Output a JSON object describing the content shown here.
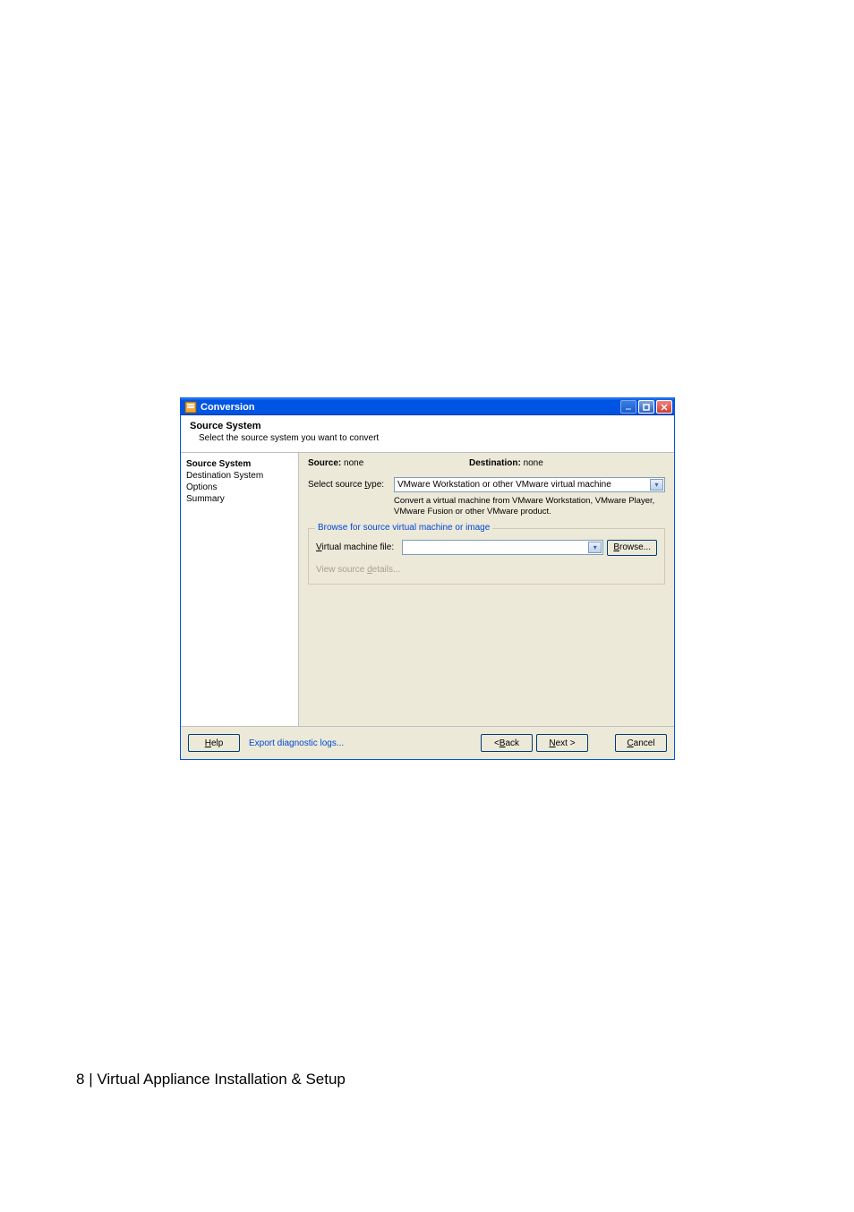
{
  "page_footer": {
    "number": "8",
    "separator": " | ",
    "title": "Virtual Appliance Installation & Setup"
  },
  "window": {
    "title": "Conversion",
    "header": {
      "title": "Source System",
      "subtitle": "Select the source system you want to convert"
    },
    "sidebar": {
      "items": [
        {
          "label": "Source System",
          "active": true
        },
        {
          "label": "Destination System",
          "active": false
        },
        {
          "label": "Options",
          "active": false
        },
        {
          "label": "Summary",
          "active": false
        }
      ]
    },
    "content": {
      "source_label": "Source:",
      "source_value": "none",
      "destination_label": "Destination:",
      "destination_value": "none",
      "select_type": {
        "label_prefix": "Select source ",
        "label_ul": "t",
        "label_suffix": "ype:",
        "value": "VMware Workstation or other VMware virtual machine"
      },
      "hint": "Convert a virtual machine from VMware Workstation, VMware Player, VMware Fusion or other VMware product.",
      "fieldset": {
        "legend": "Browse for source virtual machine or image",
        "vm_file": {
          "label_ul": "V",
          "label_rest": "irtual machine file:",
          "value": ""
        },
        "browse": {
          "label_ul": "B",
          "label_rest": "rowse..."
        },
        "view_details": {
          "prefix": "View source ",
          "ul": "d",
          "suffix": "etails..."
        }
      }
    },
    "footer": {
      "help": {
        "ul": "H",
        "rest": "elp"
      },
      "export": "Export diagnostic logs...",
      "back": {
        "prefix": "< ",
        "ul": "B",
        "rest": "ack"
      },
      "next": {
        "ul": "N",
        "rest": "ext >"
      },
      "cancel": {
        "ul": "C",
        "rest": "ancel"
      }
    }
  }
}
